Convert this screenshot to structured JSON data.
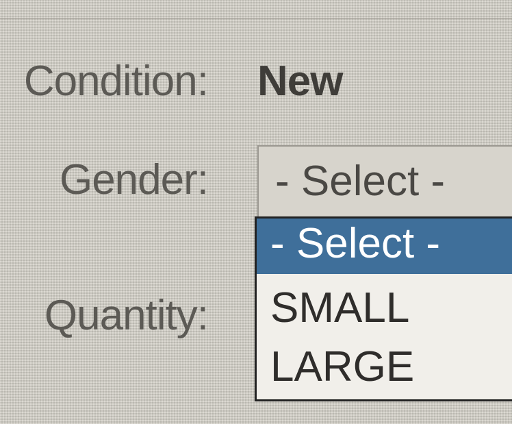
{
  "form": {
    "condition": {
      "label": "Condition:",
      "value": "New"
    },
    "gender": {
      "label": "Gender:",
      "selected": "- Select -",
      "options": [
        "- Select -",
        "SMALL",
        "LARGE"
      ]
    },
    "quantity": {
      "label": "Quantity:"
    }
  },
  "colors": {
    "selected_option_bg": "#3f6f9a",
    "selected_option_text": "#ffffff",
    "dropdown_bg": "#f1efea"
  }
}
